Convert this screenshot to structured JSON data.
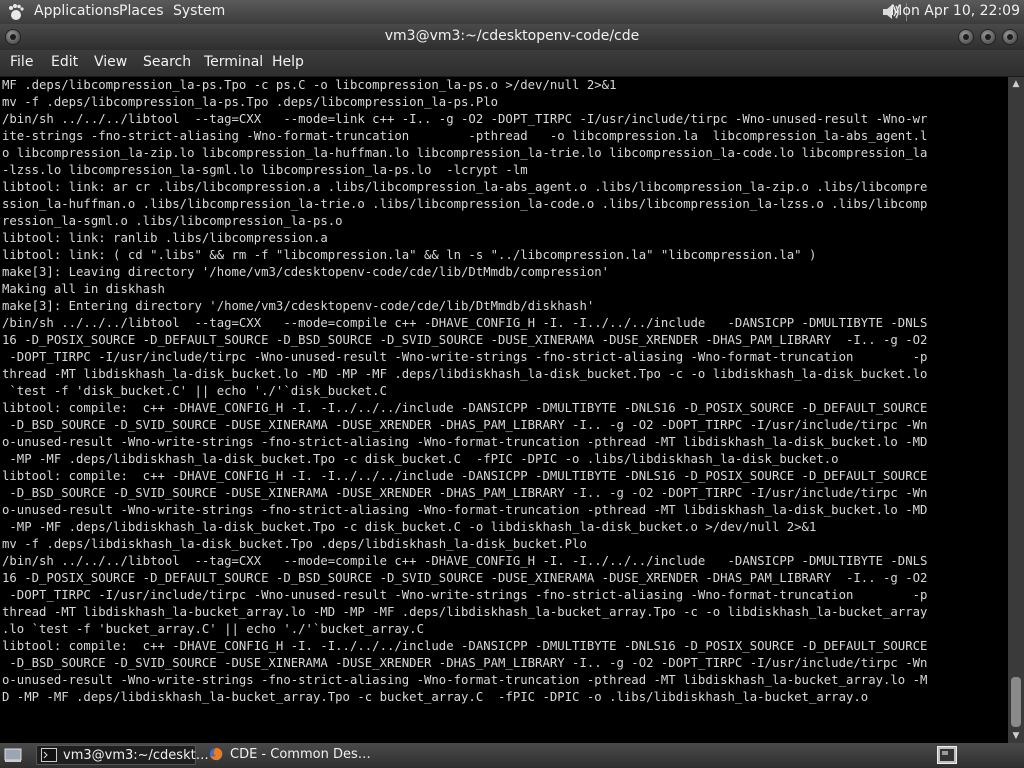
{
  "top_panel": {
    "applications": "Applications",
    "places": "Places",
    "system": "System",
    "clock": "Mon Apr 10, 22:09"
  },
  "window": {
    "title": "vm3@vm3:~/cdesktopenv-code/cde"
  },
  "menubar": [
    "File",
    "Edit",
    "View",
    "Search",
    "Terminal",
    "Help"
  ],
  "terminal": {
    "lines": [
      "MF .deps/libcompression_la-ps.Tpo -c ps.C -o libcompression_la-ps.o >/dev/null 2>&1",
      "mv -f .deps/libcompression_la-ps.Tpo .deps/libcompression_la-ps.Plo",
      "/bin/sh ../../../libtool  --tag=CXX   --mode=link c++ -I.. -g -O2 -DOPT_TIRPC -I/usr/include/tirpc -Wno-unused-result -Wno-wr",
      "ite-strings -fno-strict-aliasing -Wno-format-truncation        -pthread   -o libcompression.la  libcompression_la-abs_agent.l",
      "o libcompression_la-zip.lo libcompression_la-huffman.lo libcompression_la-trie.lo libcompression_la-code.lo libcompression_la",
      "-lzss.lo libcompression_la-sgml.lo libcompression_la-ps.lo  -lcrypt -lm",
      "libtool: link: ar cr .libs/libcompression.a .libs/libcompression_la-abs_agent.o .libs/libcompression_la-zip.o .libs/libcompre",
      "ssion_la-huffman.o .libs/libcompression_la-trie.o .libs/libcompression_la-code.o .libs/libcompression_la-lzss.o .libs/libcomp",
      "ression_la-sgml.o .libs/libcompression_la-ps.o",
      "libtool: link: ranlib .libs/libcompression.a",
      "libtool: link: ( cd \".libs\" && rm -f \"libcompression.la\" && ln -s \"../libcompression.la\" \"libcompression.la\" )",
      "make[3]: Leaving directory '/home/vm3/cdesktopenv-code/cde/lib/DtMmdb/compression'",
      "Making all in diskhash",
      "make[3]: Entering directory '/home/vm3/cdesktopenv-code/cde/lib/DtMmdb/diskhash'",
      "/bin/sh ../../../libtool  --tag=CXX   --mode=compile c++ -DHAVE_CONFIG_H -I. -I../../../include   -DANSICPP -DMULTIBYTE -DNLS",
      "16 -D_POSIX_SOURCE -D_DEFAULT_SOURCE -D_BSD_SOURCE -D_SVID_SOURCE -DUSE_XINERAMA -DUSE_XRENDER -DHAS_PAM_LIBRARY  -I.. -g -O2",
      " -DOPT_TIRPC -I/usr/include/tirpc -Wno-unused-result -Wno-write-strings -fno-strict-aliasing -Wno-format-truncation        -p",
      "thread -MT libdiskhash_la-disk_bucket.lo -MD -MP -MF .deps/libdiskhash_la-disk_bucket.Tpo -c -o libdiskhash_la-disk_bucket.lo",
      " `test -f 'disk_bucket.C' || echo './'`disk_bucket.C",
      "libtool: compile:  c++ -DHAVE_CONFIG_H -I. -I../../../include -DANSICPP -DMULTIBYTE -DNLS16 -D_POSIX_SOURCE -D_DEFAULT_SOURCE",
      " -D_BSD_SOURCE -D_SVID_SOURCE -DUSE_XINERAMA -DUSE_XRENDER -DHAS_PAM_LIBRARY -I.. -g -O2 -DOPT_TIRPC -I/usr/include/tirpc -Wn",
      "o-unused-result -Wno-write-strings -fno-strict-aliasing -Wno-format-truncation -pthread -MT libdiskhash_la-disk_bucket.lo -MD",
      " -MP -MF .deps/libdiskhash_la-disk_bucket.Tpo -c disk_bucket.C  -fPIC -DPIC -o .libs/libdiskhash_la-disk_bucket.o",
      "libtool: compile:  c++ -DHAVE_CONFIG_H -I. -I../../../include -DANSICPP -DMULTIBYTE -DNLS16 -D_POSIX_SOURCE -D_DEFAULT_SOURCE",
      " -D_BSD_SOURCE -D_SVID_SOURCE -DUSE_XINERAMA -DUSE_XRENDER -DHAS_PAM_LIBRARY -I.. -g -O2 -DOPT_TIRPC -I/usr/include/tirpc -Wn",
      "o-unused-result -Wno-write-strings -fno-strict-aliasing -Wno-format-truncation -pthread -MT libdiskhash_la-disk_bucket.lo -MD",
      " -MP -MF .deps/libdiskhash_la-disk_bucket.Tpo -c disk_bucket.C -o libdiskhash_la-disk_bucket.o >/dev/null 2>&1",
      "mv -f .deps/libdiskhash_la-disk_bucket.Tpo .deps/libdiskhash_la-disk_bucket.Plo",
      "/bin/sh ../../../libtool  --tag=CXX   --mode=compile c++ -DHAVE_CONFIG_H -I. -I../../../include   -DANSICPP -DMULTIBYTE -DNLS",
      "16 -D_POSIX_SOURCE -D_DEFAULT_SOURCE -D_BSD_SOURCE -D_SVID_SOURCE -DUSE_XINERAMA -DUSE_XRENDER -DHAS_PAM_LIBRARY  -I.. -g -O2",
      " -DOPT_TIRPC -I/usr/include/tirpc -Wno-unused-result -Wno-write-strings -fno-strict-aliasing -Wno-format-truncation        -p",
      "thread -MT libdiskhash_la-bucket_array.lo -MD -MP -MF .deps/libdiskhash_la-bucket_array.Tpo -c -o libdiskhash_la-bucket_array",
      ".lo `test -f 'bucket_array.C' || echo './'`bucket_array.C",
      "libtool: compile:  c++ -DHAVE_CONFIG_H -I. -I../../../include -DANSICPP -DMULTIBYTE -DNLS16 -D_POSIX_SOURCE -D_DEFAULT_SOURCE",
      " -D_BSD_SOURCE -D_SVID_SOURCE -DUSE_XINERAMA -DUSE_XRENDER -DHAS_PAM_LIBRARY -I.. -g -O2 -DOPT_TIRPC -I/usr/include/tirpc -Wn",
      "o-unused-result -Wno-write-strings -fno-strict-aliasing -Wno-format-truncation -pthread -MT libdiskhash_la-bucket_array.lo -M",
      "D -MP -MF .deps/libdiskhash_la-bucket_array.Tpo -c bucket_array.C  -fPIC -DPIC -o .libs/libdiskhash_la-bucket_array.o"
    ]
  },
  "taskbar": {
    "tasks": [
      {
        "label": "vm3@vm3:~/cdeskt…",
        "icon": "terminal-icon"
      },
      {
        "label": "CDE - Common Des…",
        "icon": "firefox-icon"
      }
    ]
  },
  "icons": {
    "apps": "foot-icon",
    "volume": "speaker-icon",
    "show_desktop": "show-desktop-icon",
    "workspace": "workspace-switcher-icon"
  },
  "colors": {
    "terminal_bg": "#000000",
    "terminal_fg": "#d8d8d8",
    "panel": "#3c3c3c"
  }
}
